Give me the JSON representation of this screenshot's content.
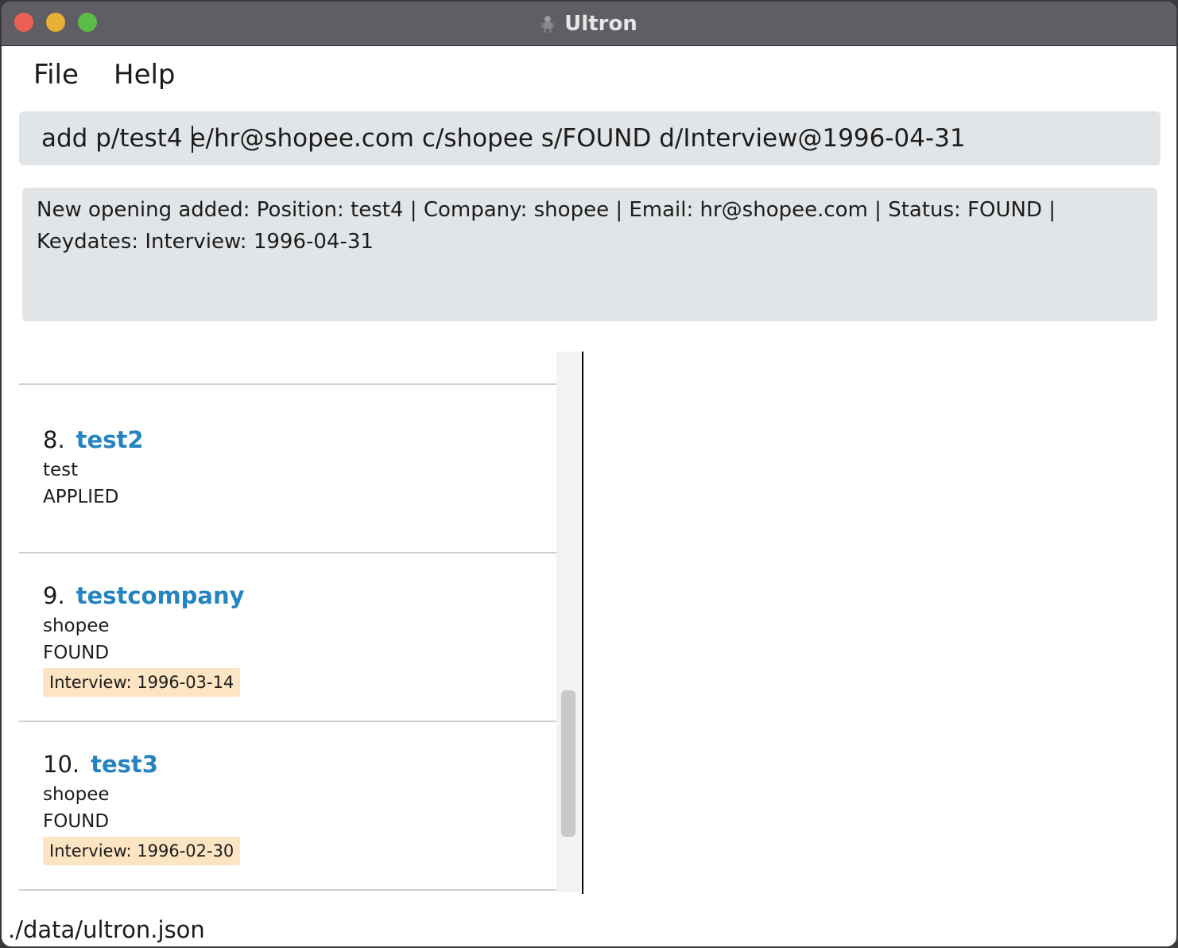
{
  "window": {
    "title": "Ultron",
    "app_icon": "robot-icon"
  },
  "menu": {
    "file": "File",
    "help": "Help"
  },
  "command": {
    "value": "add p/test4 e/hr@shopee.com c/shopee s/FOUND d/Interview@1996-04-31"
  },
  "result": {
    "message": "New opening added: Position: test4 | Company: shopee | Email: hr@shopee.com | Status: FOUND | Keydates: Interview: 1996-04-31"
  },
  "openings": [
    {
      "index": "8.",
      "position": "test2",
      "company": "test",
      "status": "APPLIED",
      "keydate": ""
    },
    {
      "index": "9.",
      "position": "testcompany",
      "company": "shopee",
      "status": "FOUND",
      "keydate": "Interview: 1996-03-14"
    },
    {
      "index": "10.",
      "position": "test3",
      "company": "shopee",
      "status": "FOUND",
      "keydate": "Interview: 1996-02-30"
    }
  ],
  "status_bar": {
    "file_path": "./data/ultron.json"
  },
  "colors": {
    "position_text": "#2484c0",
    "keydate_tag": "#fde4c2",
    "panel_bg": "#e2e5e8"
  }
}
